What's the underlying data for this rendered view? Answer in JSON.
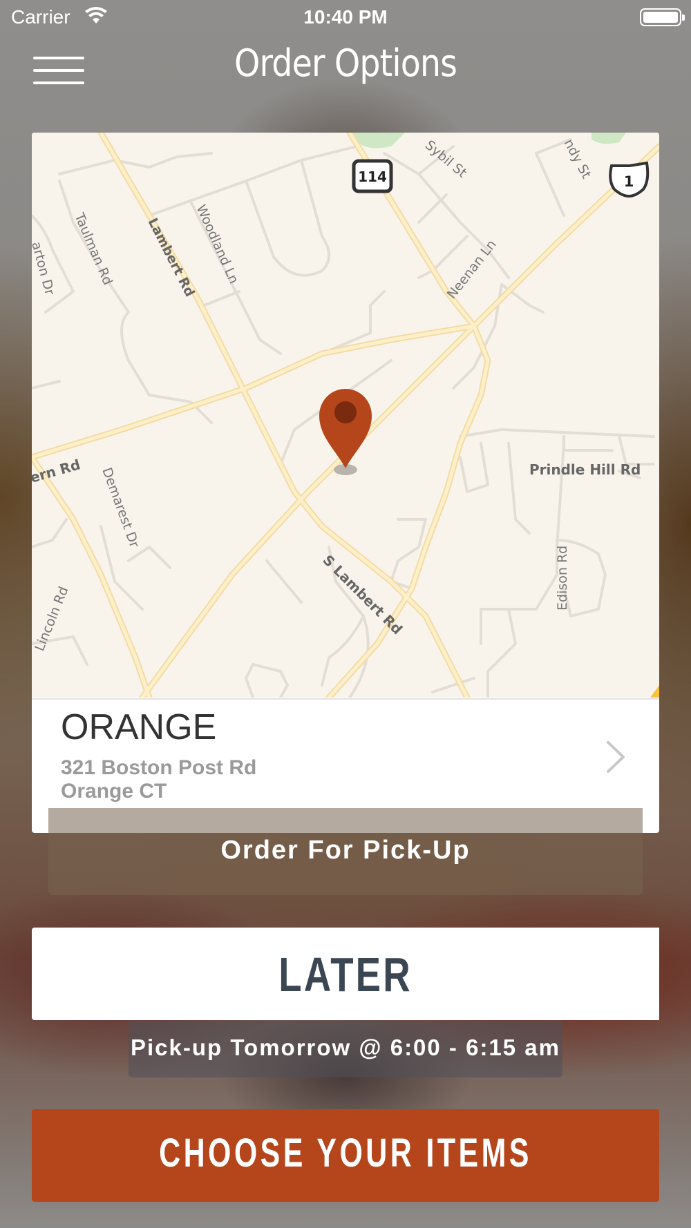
{
  "status_bar": {
    "carrier": "Carrier",
    "time": "10:40 PM"
  },
  "nav": {
    "title": "Order Options",
    "menu_icon": "hamburger-menu-icon"
  },
  "map": {
    "labels": {
      "lambert_rd": "Lambert Rd",
      "woodland_ln": "Woodland Ln",
      "taulman_rd": "Taulman Rd",
      "barton_dr": "arton Dr",
      "sybil_st": "Sybil St",
      "sandy_st": "ndy St",
      "neenan_ln": "Neenan Ln",
      "prindle_hill_rd": "Prindle Hill Rd",
      "fern_rd": "ern Rd",
      "demarest_dr": "Demarest Dr",
      "s_lambert_rd": "S Lambert Rd",
      "edison_rd": "Edison Rd",
      "lincoln_rd": "Lincoln Rd",
      "route_114": "114",
      "route_1": "1"
    },
    "pin_color": "#b5451b"
  },
  "store": {
    "name": "ORANGE",
    "address_line1": "321 Boston Post Rd",
    "address_line2": "Orange CT"
  },
  "order_type": {
    "label": "Order For Pick-Up"
  },
  "timing": {
    "later_label": "LATER",
    "pickup_time": "Pick-up Tomorrow @ 6:00 - 6:15 am"
  },
  "cta": {
    "label": "CHOOSE YOUR ITEMS",
    "color": "#b5451b"
  }
}
